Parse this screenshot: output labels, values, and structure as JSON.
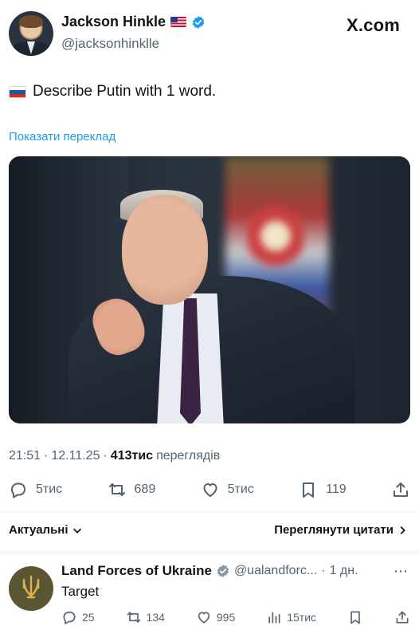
{
  "header": {
    "name": "Jackson Hinkle",
    "handle": "@jacksonhinklle",
    "site": "X.com",
    "flag_icon": "us-flag-icon",
    "verified_color": "#1d9bf0"
  },
  "tweet": {
    "flag_icon": "russia-flag-icon",
    "text": "Describe Putin with 1 word.",
    "translate": "Показати переклад"
  },
  "meta": {
    "time": "21:51",
    "separator1": "·",
    "date": "12.11.25",
    "separator2": "·",
    "views_count": "413тис",
    "views_label": "переглядів"
  },
  "actions": {
    "replies": "5тис",
    "reposts": "689",
    "likes": "5тис",
    "bookmarks": "119"
  },
  "sort": {
    "label": "Актуальні",
    "quotes_label": "Переглянути цитати"
  },
  "reply": {
    "name": "Land Forces of Ukraine",
    "handle": "@ualandforc...",
    "separator": "·",
    "time": "1 дн.",
    "text": "Target",
    "replies": "25",
    "reposts": "134",
    "likes": "995",
    "views": "15тис"
  },
  "colors": {
    "link": "#1d9bf0",
    "muted": "#536471",
    "text": "#0f1419"
  }
}
